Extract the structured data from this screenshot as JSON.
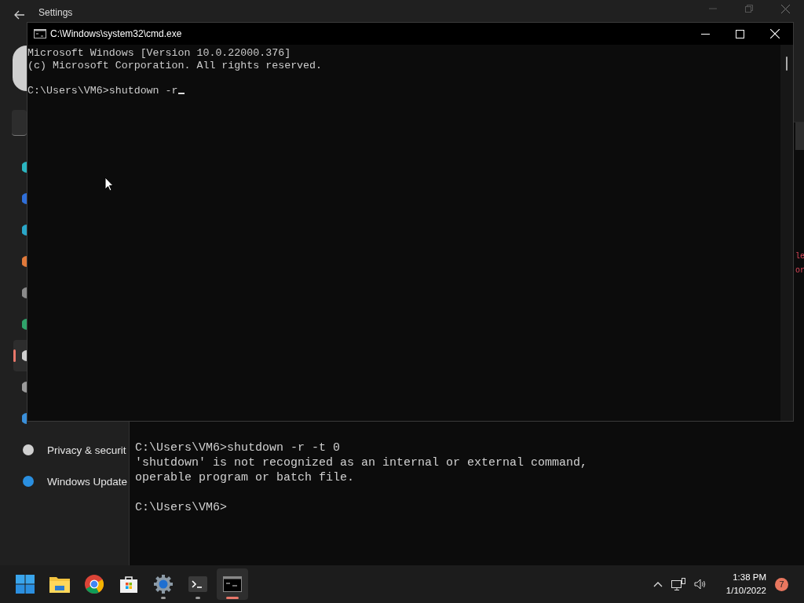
{
  "settings_window": {
    "title": "Settings",
    "sidebar_items": [
      {
        "color": "#2bb5c0",
        "selected": false
      },
      {
        "color": "#2f6fd9",
        "selected": false
      },
      {
        "color": "#2aa7c9",
        "selected": false
      },
      {
        "color": "#e0793a",
        "selected": false
      },
      {
        "color": "#8a8a8a",
        "selected": false
      },
      {
        "color": "#2fa36b",
        "selected": false
      },
      {
        "color": "#cfcfcf",
        "selected": true
      },
      {
        "color": "#9a9a9a",
        "selected": false
      },
      {
        "color": "#3a8fd9",
        "selected": false
      },
      {
        "color": "#d0d0d0",
        "label": "Privacy & securit",
        "selected": false
      },
      {
        "color": "#2a8fe0",
        "label": "Windows Update",
        "selected": false
      }
    ]
  },
  "background_terminal": {
    "blocks": [
      [
        "C:\\Users\\VM6>shutdown -r -t 0",
        "'shutdown' is not recognized as an internal or external command,",
        "operable program or batch file."
      ],
      [
        "C:\\Users\\VM6>"
      ]
    ],
    "edge_fragments": [
      "le",
      "or"
    ]
  },
  "cmd_window": {
    "title": "C:\\Windows\\system32\\cmd.exe",
    "blocks": [
      [
        "Microsoft Windows [Version 10.0.22000.376]",
        "(c) Microsoft Corporation. All rights reserved."
      ],
      [
        "C:\\Users\\VM6>shutdown -r"
      ]
    ],
    "cursor": true
  },
  "taskbar": {
    "apps": [
      {
        "kind": "start",
        "running": false,
        "selected": false
      },
      {
        "kind": "folder",
        "running": false,
        "selected": false
      },
      {
        "kind": "browser",
        "running": false,
        "selected": false
      },
      {
        "kind": "store",
        "running": false,
        "selected": false
      },
      {
        "kind": "settings",
        "running": true,
        "selected": false
      },
      {
        "kind": "terminal",
        "running": true,
        "selected": false
      },
      {
        "kind": "cmd",
        "running": true,
        "selected": true
      }
    ],
    "time": "1:38 PM",
    "date": "1/10/2022",
    "notifications": "7"
  }
}
